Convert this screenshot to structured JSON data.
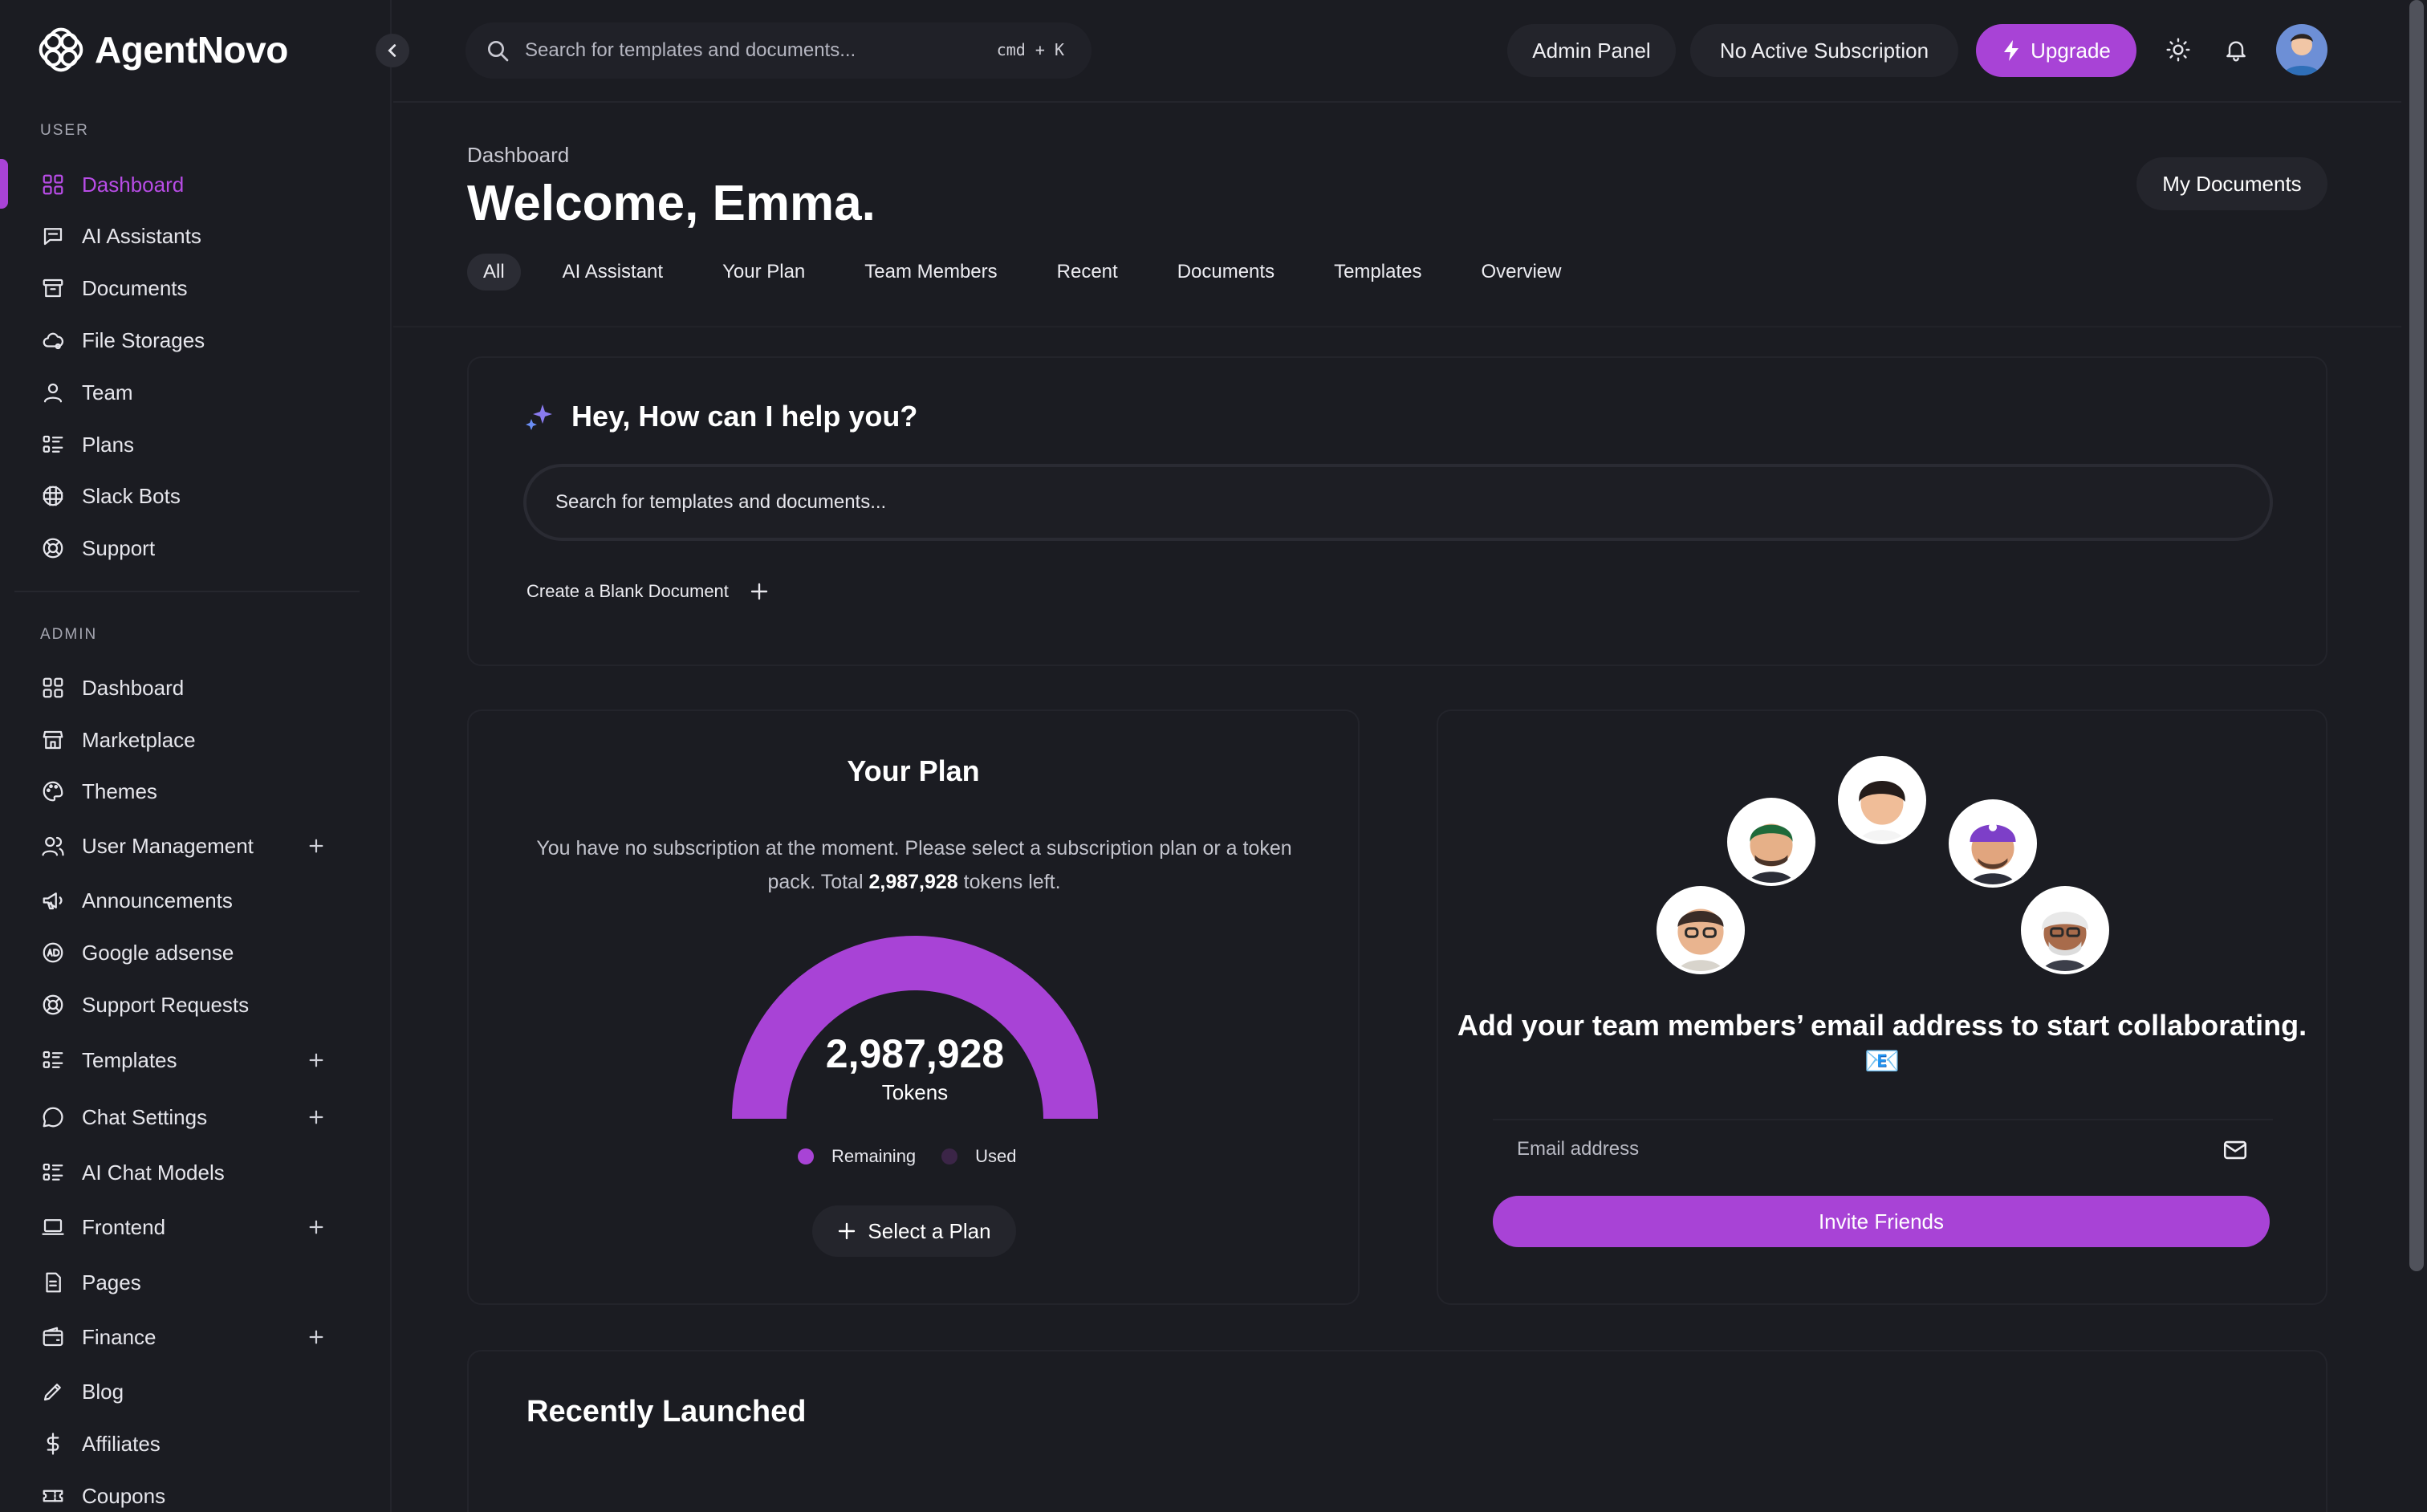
{
  "brand": {
    "name": "AgentNovo"
  },
  "sidebar": {
    "user_label": "USER",
    "admin_label": "ADMIN",
    "user_items": [
      {
        "label": "Dashboard",
        "icon": "grid-icon",
        "active": true
      },
      {
        "label": "AI Assistants",
        "icon": "chat-icon"
      },
      {
        "label": "Documents",
        "icon": "archive-icon"
      },
      {
        "label": "File Storages",
        "icon": "cloud-icon"
      },
      {
        "label": "Team",
        "icon": "user-icon"
      },
      {
        "label": "Plans",
        "icon": "list-icon"
      },
      {
        "label": "Slack Bots",
        "icon": "slack-icon"
      },
      {
        "label": "Support",
        "icon": "lifebuoy-icon"
      }
    ],
    "admin_items": [
      {
        "label": "Dashboard",
        "icon": "grid-icon"
      },
      {
        "label": "Marketplace",
        "icon": "store-icon"
      },
      {
        "label": "Themes",
        "icon": "palette-icon"
      },
      {
        "label": "User Management",
        "icon": "users-icon",
        "expandable": true
      },
      {
        "label": "Announcements",
        "icon": "megaphone-icon"
      },
      {
        "label": "Google adsense",
        "icon": "ad-icon"
      },
      {
        "label": "Support Requests",
        "icon": "lifebuoy-icon"
      },
      {
        "label": "Templates",
        "icon": "list-icon",
        "expandable": true
      },
      {
        "label": "Chat Settings",
        "icon": "chat-bubble-icon",
        "expandable": true
      },
      {
        "label": "AI Chat Models",
        "icon": "list-icon"
      },
      {
        "label": "Frontend",
        "icon": "laptop-icon",
        "expandable": true
      },
      {
        "label": "Pages",
        "icon": "page-icon"
      },
      {
        "label": "Finance",
        "icon": "wallet-icon",
        "expandable": true
      },
      {
        "label": "Blog",
        "icon": "pen-icon"
      },
      {
        "label": "Affiliates",
        "icon": "dollar-icon"
      },
      {
        "label": "Coupons",
        "icon": "ticket-icon"
      }
    ]
  },
  "topbar": {
    "search_placeholder": "Search for templates and documents...",
    "shortcut": "cmd + K",
    "admin_panel": "Admin Panel",
    "subscription": "No Active Subscription",
    "upgrade": "Upgrade"
  },
  "header": {
    "breadcrumb": "Dashboard",
    "title": "Welcome, Emma.",
    "my_documents": "My Documents",
    "tabs": [
      "All",
      "AI Assistant",
      "Your Plan",
      "Team Members",
      "Recent",
      "Documents",
      "Templates",
      "Overview"
    ]
  },
  "help": {
    "title": "Hey, How can I help you?",
    "input_placeholder": "Search for templates and documents...",
    "create_blank": "Create a Blank Document"
  },
  "plan": {
    "title": "Your Plan",
    "desc_prefix": "You have no subscription at the moment. Please select a subscription plan or a token pack. Total ",
    "desc_tokens": "2,987,928",
    "desc_suffix": " tokens left.",
    "tokens_value": "2,987,928",
    "tokens_unit": "Tokens",
    "remaining_fraction": 1.0,
    "legend_remaining": "Remaining",
    "legend_used": "Used",
    "select_plan": "Select a Plan"
  },
  "team": {
    "message": "Add your team members’ email address to start collaborating. 📧",
    "email_placeholder": "Email address",
    "invite": "Invite Friends"
  },
  "recent": {
    "title": "Recently Launched"
  },
  "colors": {
    "accent": "#a843d6",
    "used": "#3b2547",
    "bg": "#1b1c22"
  }
}
